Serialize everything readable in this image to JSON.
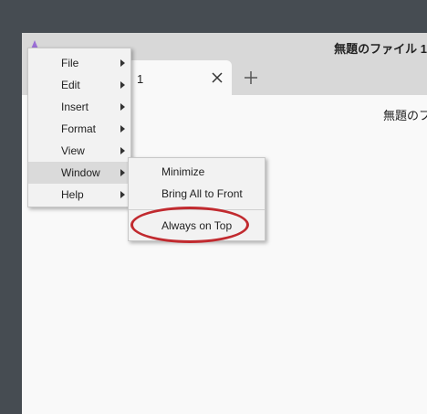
{
  "window": {
    "title": "無題のファイル 1",
    "document_title": "無題のフ"
  },
  "tab": {
    "label": "1"
  },
  "menu": {
    "items": [
      {
        "label": "File",
        "has_submenu": true
      },
      {
        "label": "Edit",
        "has_submenu": true
      },
      {
        "label": "Insert",
        "has_submenu": true
      },
      {
        "label": "Format",
        "has_submenu": true
      },
      {
        "label": "View",
        "has_submenu": true
      },
      {
        "label": "Window",
        "has_submenu": true,
        "active": true
      },
      {
        "label": "Help",
        "has_submenu": true
      }
    ]
  },
  "window_submenu": {
    "items": [
      {
        "label": "Minimize"
      },
      {
        "label": "Bring All to Front"
      },
      {
        "label": "Always on Top"
      }
    ]
  },
  "icons": {
    "app": "app-logo-icon",
    "tab_close": "close-icon",
    "new_tab": "plus-icon"
  },
  "colors": {
    "highlight_ring": "#c12a2f",
    "app_icon": "#9b6fd6"
  }
}
